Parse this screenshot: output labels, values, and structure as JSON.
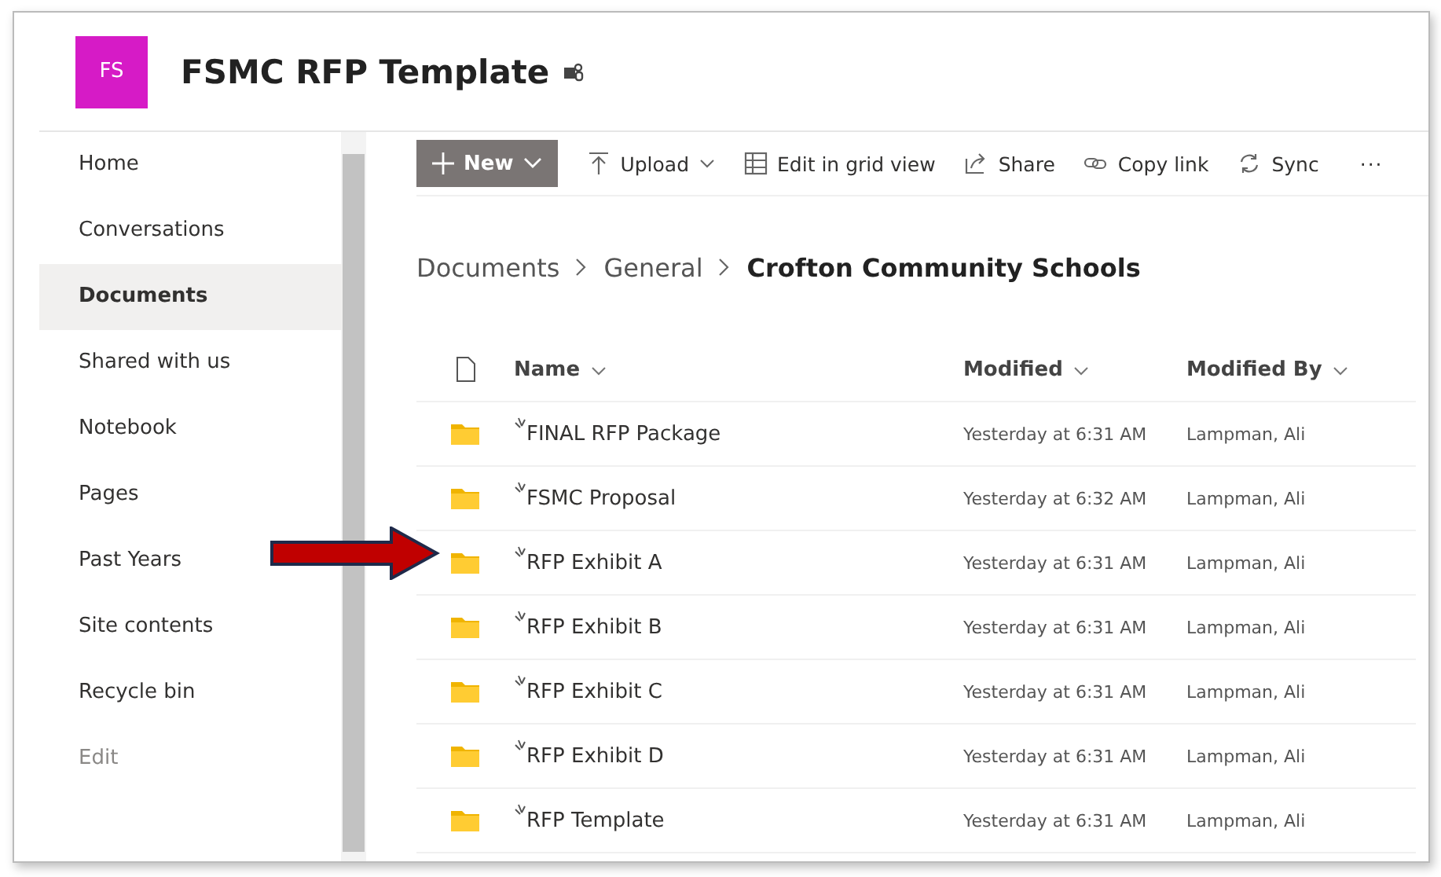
{
  "site": {
    "logo": "FS",
    "title": "FSMC RFP Template"
  },
  "sidebar": {
    "items": [
      {
        "label": "Home",
        "selected": false,
        "disabled": false
      },
      {
        "label": "Conversations",
        "selected": false,
        "disabled": false
      },
      {
        "label": "Documents",
        "selected": true,
        "disabled": false
      },
      {
        "label": "Shared with us",
        "selected": false,
        "disabled": false
      },
      {
        "label": "Notebook",
        "selected": false,
        "disabled": false
      },
      {
        "label": "Pages",
        "selected": false,
        "disabled": false
      },
      {
        "label": "Past Years",
        "selected": false,
        "disabled": false
      },
      {
        "label": "Site contents",
        "selected": false,
        "disabled": false
      },
      {
        "label": "Recycle bin",
        "selected": false,
        "disabled": false
      },
      {
        "label": "Edit",
        "selected": false,
        "disabled": true
      }
    ]
  },
  "toolbar": [
    {
      "kind": "new",
      "label": "New"
    },
    {
      "kind": "upload",
      "label": "Upload"
    },
    {
      "kind": "grid",
      "label": "Edit in grid view"
    },
    {
      "kind": "share",
      "label": "Share"
    },
    {
      "kind": "link",
      "label": "Copy link"
    },
    {
      "kind": "sync",
      "label": "Sync"
    },
    {
      "kind": "more",
      "label": "···"
    }
  ],
  "breadcrumb": [
    "Documents",
    "General",
    "Crofton Community Schools"
  ],
  "table": {
    "columns": [
      "Name",
      "Modified",
      "Modified By"
    ],
    "rows": [
      {
        "name": "FINAL RFP Package",
        "modified": "Yesterday at 6:31 AM",
        "modified_by": "Lampman, Ali",
        "pointed": false
      },
      {
        "name": "FSMC Proposal",
        "modified": "Yesterday at 6:32 AM",
        "modified_by": "Lampman, Ali",
        "pointed": false
      },
      {
        "name": "RFP Exhibit A",
        "modified": "Yesterday at 6:31 AM",
        "modified_by": "Lampman, Ali",
        "pointed": true
      },
      {
        "name": "RFP Exhibit B",
        "modified": "Yesterday at 6:31 AM",
        "modified_by": "Lampman, Ali",
        "pointed": false
      },
      {
        "name": "RFP Exhibit C",
        "modified": "Yesterday at 6:31 AM",
        "modified_by": "Lampman, Ali",
        "pointed": false
      },
      {
        "name": "RFP Exhibit D",
        "modified": "Yesterday at 6:31 AM",
        "modified_by": "Lampman, Ali",
        "pointed": false
      },
      {
        "name": "RFP Template",
        "modified": "Yesterday at 6:31 AM",
        "modified_by": "Lampman, Ali",
        "pointed": false
      }
    ]
  }
}
